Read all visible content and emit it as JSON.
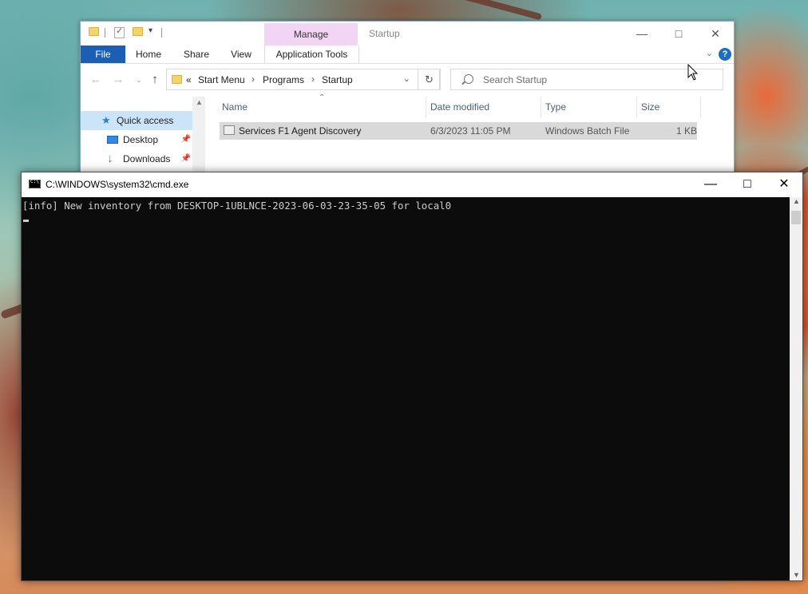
{
  "explorer": {
    "window_title": "Startup",
    "quick_access_toolbar": [
      "folder-icon",
      "properties-icon",
      "new-folder-icon",
      "customize-dropdown-icon"
    ],
    "context_tab_group": "Manage",
    "ribbon_tabs": [
      "File",
      "Home",
      "Share",
      "View"
    ],
    "context_tab": "Application Tools",
    "breadcrumb": {
      "overflow": "«",
      "items": [
        "Start Menu",
        "Programs",
        "Startup"
      ]
    },
    "search_placeholder": "Search Startup",
    "nav_pane": [
      {
        "label": "Quick access",
        "icon": "star-icon",
        "selected": true
      },
      {
        "label": "Desktop",
        "icon": "desktop-icon",
        "pinned": true
      },
      {
        "label": "Downloads",
        "icon": "download-arrow-icon",
        "pinned": true
      }
    ],
    "columns": [
      "Name",
      "Date modified",
      "Type",
      "Size"
    ],
    "files": [
      {
        "name": "Services F1 Agent Discovery",
        "date_modified": "6/3/2023 11:05 PM",
        "type": "Windows Batch File",
        "size": "1 KB",
        "selected": true
      }
    ]
  },
  "cmd": {
    "title": "C:\\WINDOWS\\system32\\cmd.exe",
    "lines": [
      "[info] New inventory from DESKTOP-1UBLNCE-2023-06-03-23-35-05 for local0"
    ]
  },
  "colors": {
    "file_tab": "#1a5fb4",
    "manage_tab": "#f2d5f5",
    "selection": "#cce4f7",
    "console_bg": "#0c0c0c",
    "console_text": "#cccccc"
  }
}
